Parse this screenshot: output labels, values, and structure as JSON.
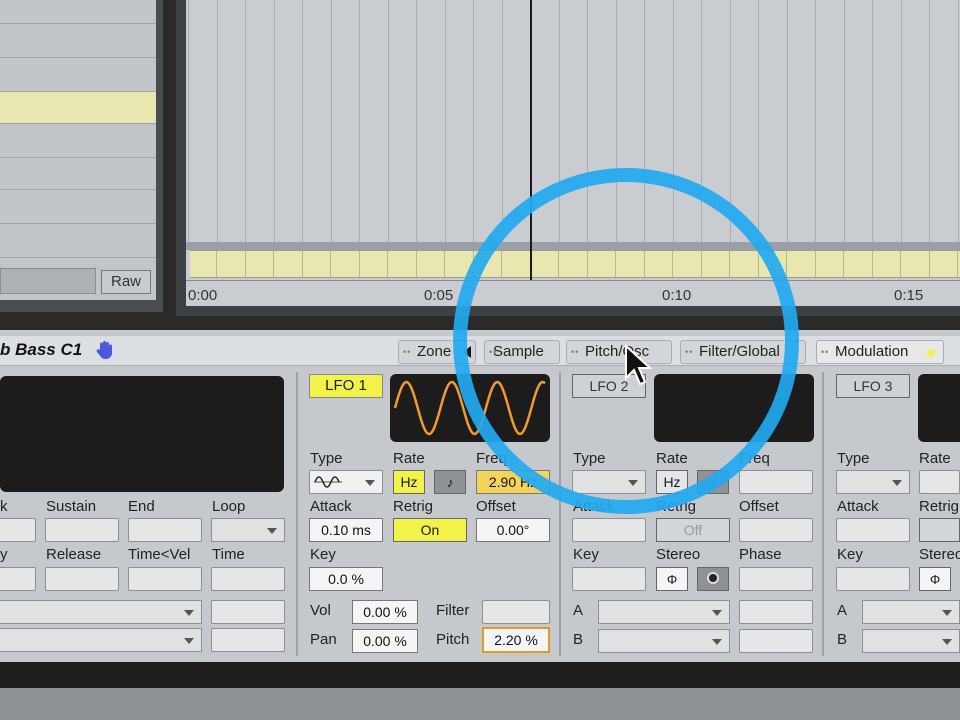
{
  "colors": {
    "accent_yellow": "#f2f24a",
    "lfo_orange": "#f29a2e",
    "highlight_ring": "#22a9f0",
    "panel": "#c5c9cd",
    "screen": "#1c1c1c",
    "clip_yellow": "#e9e7b0"
  },
  "clip_panel": {
    "raw_button": "Raw"
  },
  "timeline": {
    "markers": [
      "0:00",
      "0:05",
      "0:10",
      "0:15"
    ]
  },
  "device": {
    "name": "b Bass C1",
    "tabs": [
      "Zone",
      "Sample",
      "Pitch/Osc",
      "Filter/Global",
      "Modulation"
    ],
    "envelope": {
      "labels_row1": [
        "k",
        "Sustain",
        "End",
        "Loop"
      ],
      "labels_row2": [
        "y",
        "Release",
        "Time<Vel",
        "Time"
      ]
    },
    "lfo1": {
      "title": "LFO 1",
      "type_label": "Type",
      "rate_label": "Rate",
      "freq_label": "Freq",
      "rate_hz": "Hz",
      "rate_note": "♪",
      "freq_value": "2.90 Hz",
      "attack_label": "Attack",
      "attack_value": "0.10 ms",
      "retrig_label": "Retrig",
      "retrig_value": "On",
      "offset_label": "Offset",
      "offset_value": "0.00°",
      "key_label": "Key",
      "key_value": "0.0 %",
      "vol_label": "Vol",
      "vol_value": "0.00 %",
      "pan_label": "Pan",
      "pan_value": "0.00 %",
      "filter_label": "Filter",
      "pitch_label": "Pitch",
      "pitch_value": "2.20 %"
    },
    "lfo2": {
      "title": "LFO 2",
      "type_label": "Type",
      "rate_label": "Rate",
      "freq_label": "Freq",
      "rate_hz": "Hz",
      "rate_note": "♪",
      "attack_label": "Attack",
      "retrig_label": "Retrig",
      "retrig_value": "Off",
      "offset_label": "Offset",
      "key_label": "Key",
      "stereo_label": "Stereo",
      "phase_label": "Phase",
      "a_label": "A",
      "b_label": "B"
    },
    "lfo3": {
      "title": "LFO 3",
      "type_label": "Type",
      "rate_label": "Rate",
      "attack_label": "Attack",
      "retrig_label": "Retrig",
      "key_label": "Key",
      "stereo_label": "Stereo",
      "a_label": "A",
      "b_label": "B"
    }
  },
  "icons": [
    "hand-icon",
    "cursor-arrow-icon",
    "sine-wave-icon",
    "play-arrow-icon"
  ]
}
